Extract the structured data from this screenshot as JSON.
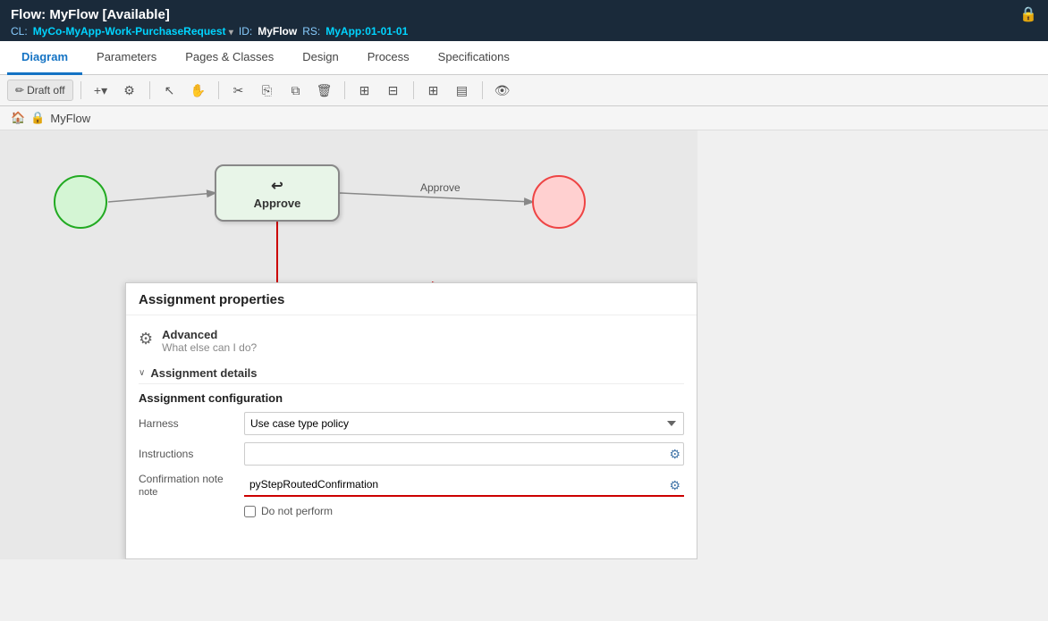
{
  "header": {
    "title": "Flow: MyFlow [Available]",
    "cl_label": "CL:",
    "cl_value": "MyCo-MyApp-Work-PurchaseRequest",
    "id_label": "ID:",
    "id_value": "MyFlow",
    "rs_label": "RS:",
    "rs_value": "MyApp:01-01-01"
  },
  "tabs": [
    {
      "id": "diagram",
      "label": "Diagram",
      "active": true
    },
    {
      "id": "parameters",
      "label": "Parameters",
      "active": false
    },
    {
      "id": "pages-classes",
      "label": "Pages & Classes",
      "active": false
    },
    {
      "id": "design",
      "label": "Design",
      "active": false
    },
    {
      "id": "process",
      "label": "Process",
      "active": false
    },
    {
      "id": "specifications",
      "label": "Specifications",
      "active": false
    }
  ],
  "toolbar": {
    "draft_off": "Draft off",
    "add_icon": "+",
    "settings_icon": "⚙",
    "select_icon": "↖",
    "hand_icon": "✋",
    "cut_icon": "✂",
    "copy_icon": "⎘",
    "paste_icon": "📋",
    "delete_icon": "🗑",
    "align_h_icon": "⊞",
    "align_v_icon": "⊟",
    "grid_icon": "⊞",
    "table_icon": "▤",
    "eye_icon": "👁"
  },
  "breadcrumb": {
    "home_icon": "🏠",
    "lock_icon": "🔒",
    "flow_name": "MyFlow"
  },
  "diagram": {
    "start_node": "start",
    "assignment_label": "Approve",
    "end_node": "end",
    "connector_label": "Approve"
  },
  "properties_panel": {
    "title": "Assignment properties",
    "advanced_icon": "⚙",
    "advanced_title": "Advanced",
    "advanced_subtitle": "What else can I do?",
    "section_chevron": "∨",
    "section_title": "Assignment details",
    "subsection_title": "Assignment configuration",
    "harness_label": "Harness",
    "harness_value": "Use case type policy",
    "instructions_label": "Instructions",
    "instructions_value": "",
    "confirmation_label": "Confirmation note",
    "confirmation_value": "pyStepRoutedConfirmation",
    "do_not_perform_label": "Do not perform",
    "do_not_perform_checked": false,
    "gear_icon": "⚙"
  }
}
